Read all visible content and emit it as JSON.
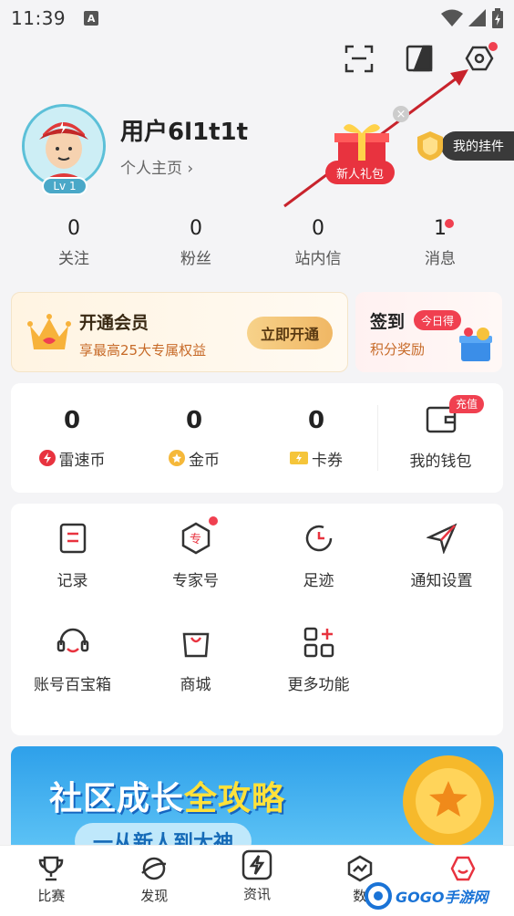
{
  "status": {
    "time": "11:39",
    "notif_letter": "A"
  },
  "profile": {
    "username": "用户6l1t1t",
    "homepage_link": "个人主页 ›",
    "level": "Lv 1",
    "gift_label": "新人礼包",
    "pendant_label": "我的挂件"
  },
  "stats": [
    {
      "value": "0",
      "label": "关注"
    },
    {
      "value": "0",
      "label": "粉丝"
    },
    {
      "value": "0",
      "label": "站内信"
    },
    {
      "value": "1",
      "label": "消息"
    }
  ],
  "vip": {
    "title": "开通会员",
    "subtitle": "享最高25大专属权益",
    "button": "立即开通"
  },
  "sign": {
    "title": "签到",
    "badge": "今日得",
    "subtitle": "积分奖励"
  },
  "wallet": {
    "items": [
      {
        "value": "0",
        "label": "雷速币"
      },
      {
        "value": "0",
        "label": "金币"
      },
      {
        "value": "0",
        "label": "卡券"
      }
    ],
    "main_label": "我的钱包",
    "recharge": "充值"
  },
  "functions": [
    {
      "label": "记录"
    },
    {
      "label": "专家号"
    },
    {
      "label": "足迹"
    },
    {
      "label": "通知设置"
    },
    {
      "label": "账号百宝箱"
    },
    {
      "label": "商城"
    },
    {
      "label": "更多功能"
    }
  ],
  "banner": {
    "title_part1": "社区成长",
    "title_part2": "全攻略",
    "subtitle": "一从新人到大神"
  },
  "nav": [
    {
      "label": "比赛",
      "icon": "trophy-icon"
    },
    {
      "label": "发现",
      "icon": "planet-icon"
    },
    {
      "label": "资讯",
      "icon": "lightning-icon"
    },
    {
      "label": "数",
      "icon": "chart-icon"
    },
    {
      "label": "",
      "icon": "profile-icon"
    }
  ],
  "watermark": "GOGO手游网",
  "colors": {
    "accent": "#f04050",
    "gold": "#f0b764",
    "blue": "#2ea0ea"
  }
}
